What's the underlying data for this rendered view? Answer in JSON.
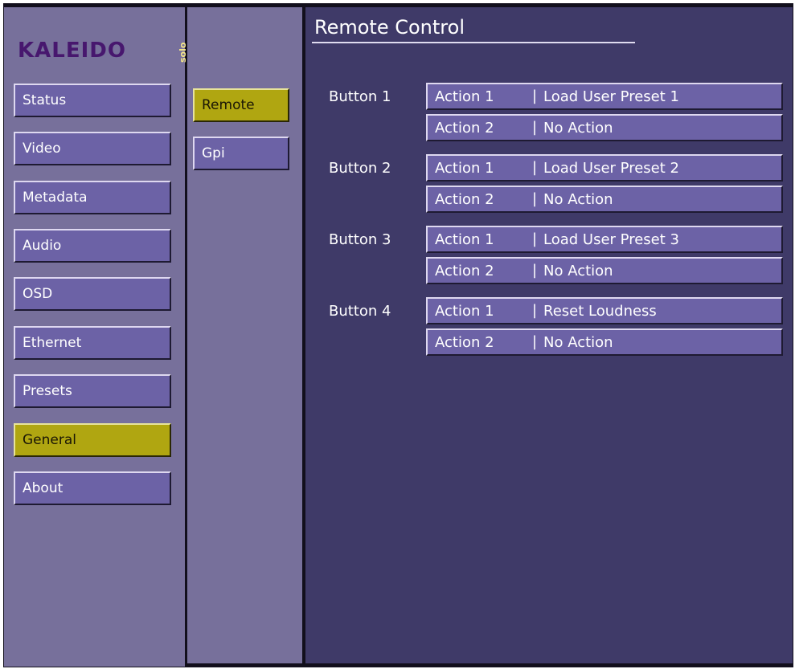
{
  "logo": {
    "word": "KALEIDO",
    "sub": "solo"
  },
  "main_menu": [
    {
      "label": "Status",
      "active": false
    },
    {
      "label": "Video",
      "active": false
    },
    {
      "label": "Metadata",
      "active": false
    },
    {
      "label": "Audio",
      "active": false
    },
    {
      "label": "OSD",
      "active": false
    },
    {
      "label": "Ethernet",
      "active": false
    },
    {
      "label": "Presets",
      "active": false
    },
    {
      "label": "General",
      "active": true
    },
    {
      "label": "About",
      "active": false
    }
  ],
  "sub_menu": [
    {
      "label": "Remote",
      "active": true
    },
    {
      "label": "Gpi",
      "active": false
    }
  ],
  "page": {
    "title": "Remote Control"
  },
  "buttons": [
    {
      "label": "Button 1",
      "actions": [
        {
          "name": "Action 1",
          "separator": "|",
          "value": "Load User Preset 1"
        },
        {
          "name": "Action 2",
          "separator": "|",
          "value": "No Action"
        }
      ]
    },
    {
      "label": "Button 2",
      "actions": [
        {
          "name": "Action 1",
          "separator": "|",
          "value": "Load User Preset 2"
        },
        {
          "name": "Action 2",
          "separator": "|",
          "value": "No Action"
        }
      ]
    },
    {
      "label": "Button 3",
      "actions": [
        {
          "name": "Action 1",
          "separator": "|",
          "value": "Load User Preset 3"
        },
        {
          "name": "Action 2",
          "separator": "|",
          "value": "No Action"
        }
      ]
    },
    {
      "label": "Button 4",
      "actions": [
        {
          "name": "Action 1",
          "separator": "|",
          "value": "Reset Loudness"
        },
        {
          "name": "Action 2",
          "separator": "|",
          "value": "No Action"
        }
      ]
    }
  ],
  "colors": {
    "panel": "#77709b",
    "main_background": "#3f3a68",
    "button": "#6c62a6",
    "active": "#b0a611",
    "logo": "#47176e"
  }
}
